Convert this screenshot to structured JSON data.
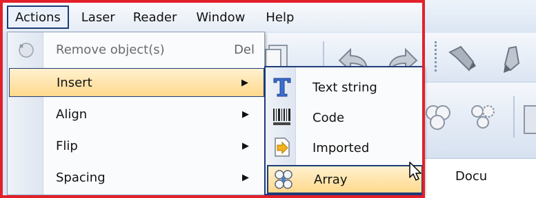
{
  "menubar": {
    "items": [
      {
        "label": "Actions",
        "active": true
      },
      {
        "label": "Laser"
      },
      {
        "label": "Reader"
      },
      {
        "label": "Window"
      },
      {
        "label": "Help"
      }
    ]
  },
  "actions_menu": {
    "items": [
      {
        "label": "Remove object(s)",
        "shortcut": "Del",
        "enabled": false,
        "icon": "eraser-icon"
      },
      {
        "label": "Insert",
        "has_submenu": true,
        "highlighted": true
      },
      {
        "label": "Align",
        "has_submenu": true
      },
      {
        "label": "Flip",
        "has_submenu": true
      },
      {
        "label": "Spacing",
        "has_submenu": true
      }
    ],
    "submenu_arrow": "▶"
  },
  "insert_submenu": {
    "items": [
      {
        "label": "Text string",
        "icon": "text-t-icon"
      },
      {
        "label": "Code",
        "icon": "barcode-icon"
      },
      {
        "label": "Imported",
        "icon": "import-file-icon"
      },
      {
        "label": "Array",
        "icon": "array-icon",
        "highlighted": true
      }
    ]
  },
  "document_tab": {
    "label": "Docu"
  },
  "colors": {
    "highlight_border": "#1d3c78",
    "highlight_fill": "#ffd98c",
    "frame_red": "#e3202a"
  }
}
